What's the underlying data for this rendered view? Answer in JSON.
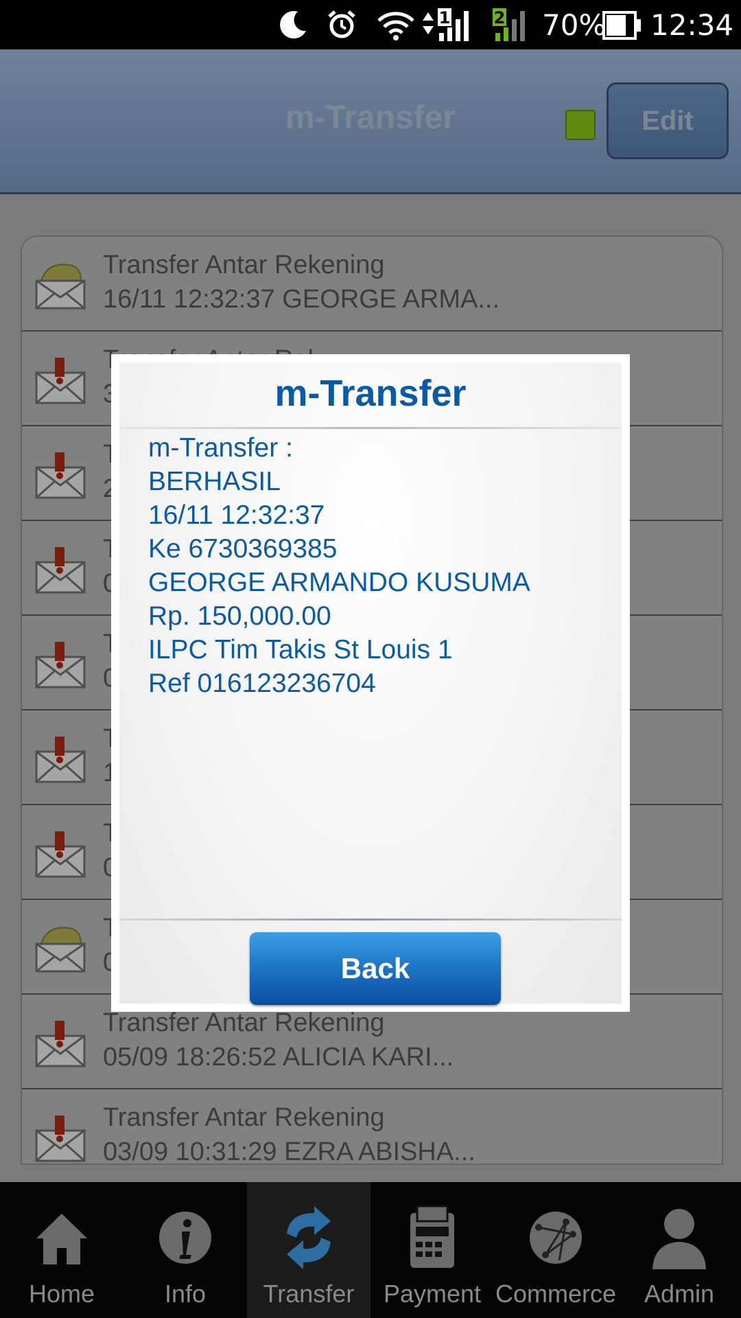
{
  "status_bar": {
    "icons": [
      "moon-icon",
      "alarm-icon",
      "wifi-icon",
      "signal-sim1-icon",
      "signal-sim2-icon",
      "battery-icon"
    ],
    "sim1_label": "1",
    "sim2_label": "2",
    "battery": "70%",
    "time": "12:34"
  },
  "header": {
    "title": "m-Transfer",
    "edit_label": "Edit",
    "status_color": "#5f8a10"
  },
  "list": {
    "items": [
      {
        "title": "Transfer Antar Rekening",
        "subtitle": "16/11 12:32:37 GEORGE ARMA...",
        "icon": "envelope-open-icon"
      },
      {
        "title": "Transfer Antar Rek...",
        "subtitle": "3...",
        "icon": "envelope-alert-icon"
      },
      {
        "title": "T",
        "subtitle": "2",
        "icon": "envelope-alert-icon"
      },
      {
        "title": "T",
        "subtitle": "0",
        "icon": "envelope-alert-icon"
      },
      {
        "title": "T",
        "subtitle": "0",
        "icon": "envelope-alert-icon"
      },
      {
        "title": "T",
        "subtitle": "1",
        "icon": "envelope-alert-icon"
      },
      {
        "title": "T",
        "subtitle": "0",
        "icon": "envelope-alert-icon"
      },
      {
        "title": "T",
        "subtitle": "0",
        "icon": "envelope-open-icon"
      },
      {
        "title": "Transfer Antar Rekening",
        "subtitle": "05/09 18:26:52 ALICIA KARI...",
        "icon": "envelope-alert-icon"
      },
      {
        "title": "Transfer Antar Rekening",
        "subtitle": "03/09 10:31:29 EZRA ABISHA...",
        "icon": "envelope-alert-icon"
      }
    ]
  },
  "dialog": {
    "title": "m-Transfer",
    "lines": [
      "m-Transfer :",
      "BERHASIL",
      "16/11 12:32:37",
      "Ke 6730369385",
      "GEORGE ARMANDO KUSUMA",
      "Rp. 150,000.00",
      "ILPC Tim Takis St Louis 1",
      "Ref 016123236704"
    ],
    "back_label": "Back",
    "text_color": "#0b5aa8"
  },
  "tabs": [
    {
      "label": "Home",
      "icon": "home-icon",
      "active": false
    },
    {
      "label": "Info",
      "icon": "info-icon",
      "active": false
    },
    {
      "label": "Transfer",
      "icon": "transfer-icon",
      "active": true
    },
    {
      "label": "Payment",
      "icon": "payment-icon",
      "active": false
    },
    {
      "label": "Commerce",
      "icon": "commerce-icon",
      "active": false
    },
    {
      "label": "Admin",
      "icon": "admin-icon",
      "active": false
    }
  ]
}
